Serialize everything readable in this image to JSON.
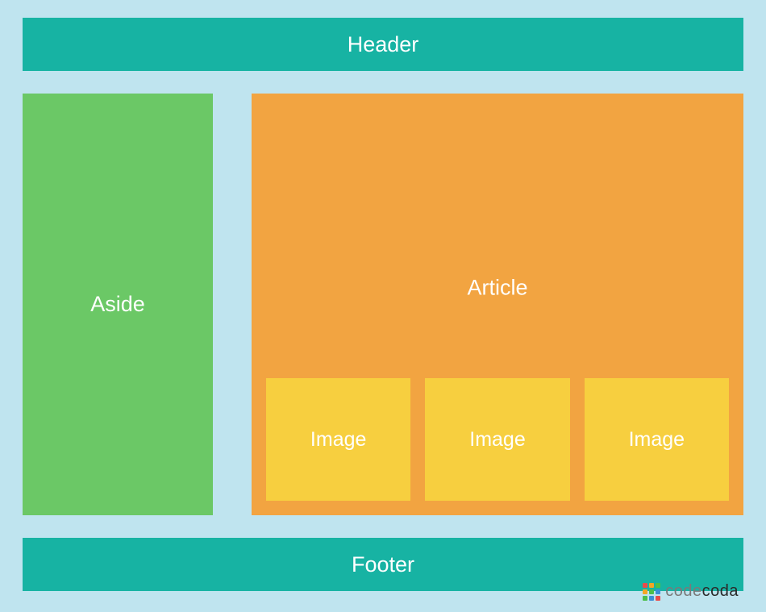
{
  "layout": {
    "header": "Header",
    "aside": "Aside",
    "article": "Article",
    "images": [
      "Image",
      "Image",
      "Image"
    ],
    "footer": "Footer"
  },
  "colors": {
    "background": "#bfe4ef",
    "header_footer": "#17b3a3",
    "aside": "#6bc866",
    "article": "#f2a441",
    "image_box": "#f7cf3f"
  },
  "brand": {
    "name_part1": "code",
    "name_part2": "coda"
  }
}
